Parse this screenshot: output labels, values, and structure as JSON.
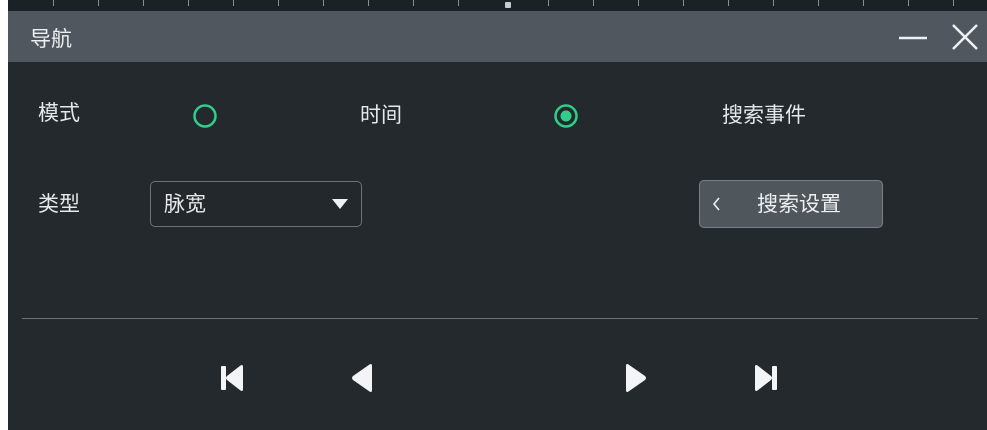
{
  "window": {
    "title": "导航"
  },
  "mode": {
    "label": "模式",
    "options": [
      {
        "label": "时间",
        "selected": false
      },
      {
        "label": "搜索事件",
        "selected": true
      }
    ]
  },
  "type": {
    "label": "类型",
    "selected_value": "脉宽"
  },
  "search_settings": {
    "label": "搜索设置"
  },
  "colors": {
    "accent": "#2fcf8a",
    "background": "#24292d",
    "titlebar": "#50575e"
  },
  "icons": {
    "minimize": "minimize-icon",
    "close": "close-icon",
    "dropdown": "caret-down-icon",
    "search_chevron": "chevron-left-icon",
    "nav": [
      "skip-to-first-icon",
      "previous-icon",
      "next-icon",
      "skip-to-last-icon"
    ]
  }
}
